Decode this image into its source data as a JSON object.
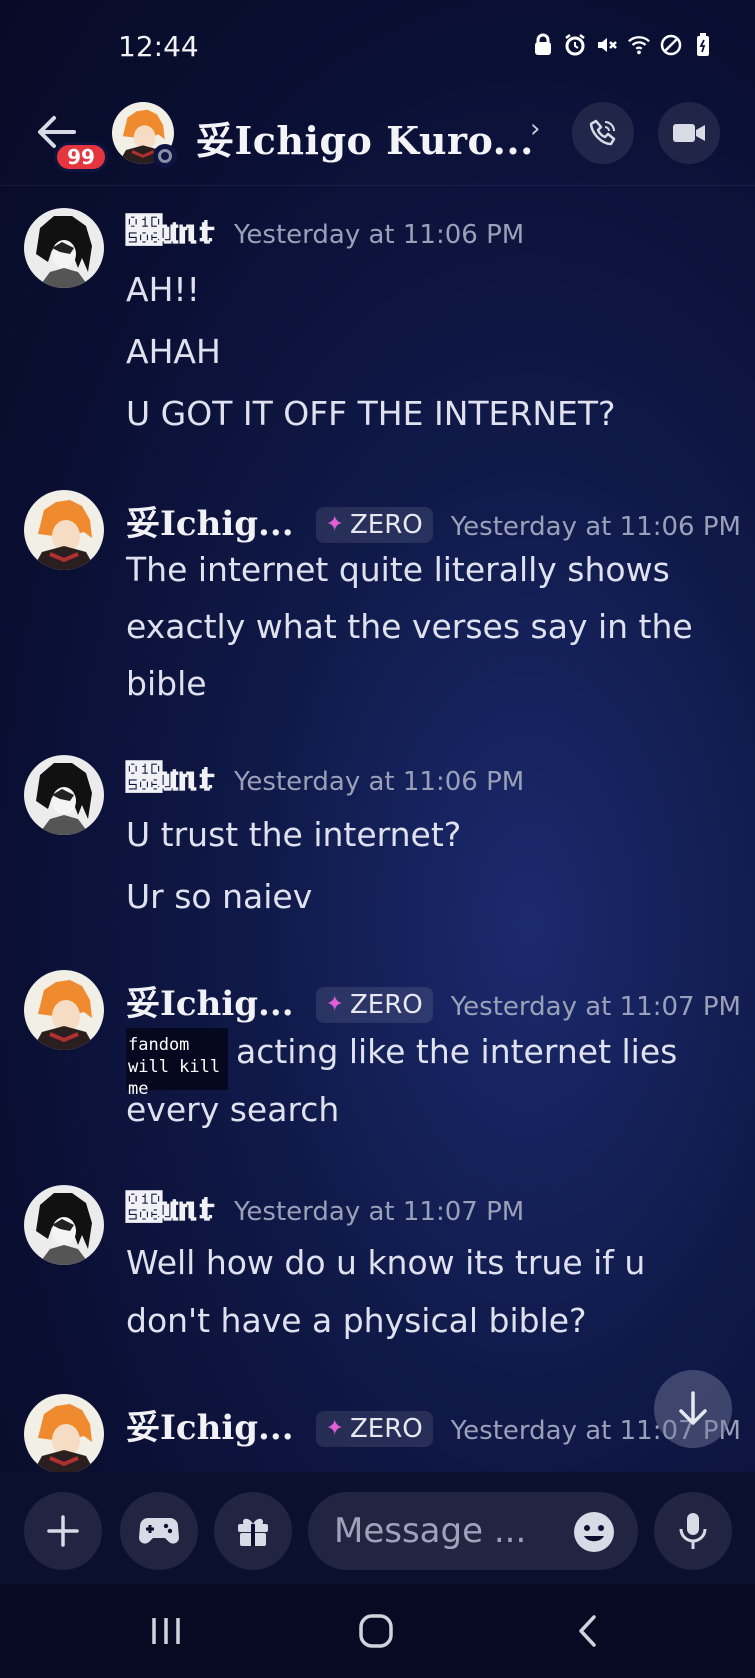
{
  "status_bar": {
    "time": "12:44",
    "icons": [
      "lock-icon",
      "alarm-icon",
      "mute-icon",
      "wifi-icon",
      "do-not-disturb-icon",
      "battery-icon"
    ]
  },
  "header": {
    "back_icon": "arrow-left-icon",
    "unread_badge": "99",
    "channel_name": "妥Ichigo Kuro...",
    "chevron": "›",
    "call_icon": "phone-icon",
    "video_icon": "video-camera-icon"
  },
  "messages": [
    {
      "author": "𝔆𝔲𝔫𝔱",
      "timestamp": "Yesterday at 11:06 PM",
      "lines": [
        "AH!!",
        "AHAH",
        "U GOT IT OFF THE INTERNET?"
      ]
    },
    {
      "author": "妥Ichig...",
      "tag": "ZERO",
      "timestamp": "Yesterday at 11:06 PM",
      "lines": [
        "The internet quite literally shows",
        "exactly what the verses say in the",
        "bible"
      ]
    },
    {
      "author": "𝔆𝔲𝔫𝔱",
      "timestamp": "Yesterday at 11:06 PM",
      "lines": [
        "U trust the internet?",
        "Ur so naiev"
      ]
    },
    {
      "author": "妥Ichig...",
      "tag": "ZERO",
      "timestamp": "Yesterday at 11:07 PM",
      "emoji_text": "fandom will kill me",
      "lines": [
        "acting like the internet lies",
        "every search"
      ]
    },
    {
      "author": "𝔆𝔲𝔫𝔱",
      "timestamp": "Yesterday at 11:07 PM",
      "lines": [
        "Well how do u know its true if u",
        "don't have a physical bible?"
      ]
    },
    {
      "author": "妥Ichig...",
      "tag": "ZERO",
      "timestamp": "Yesterday at 11:07 PM",
      "lines": []
    }
  ],
  "composer": {
    "placeholder": "Message ...",
    "plus_icon": "plus-icon",
    "game_icon": "gamepad-icon",
    "gift_icon": "gift-icon",
    "emoji_icon": "emoji-icon",
    "mic_icon": "microphone-icon"
  },
  "colors": {
    "background": "#0a0f33",
    "badge": "#e5353e",
    "tag_spark": "#e05fd6",
    "timestamp": "#9aa0b8"
  }
}
